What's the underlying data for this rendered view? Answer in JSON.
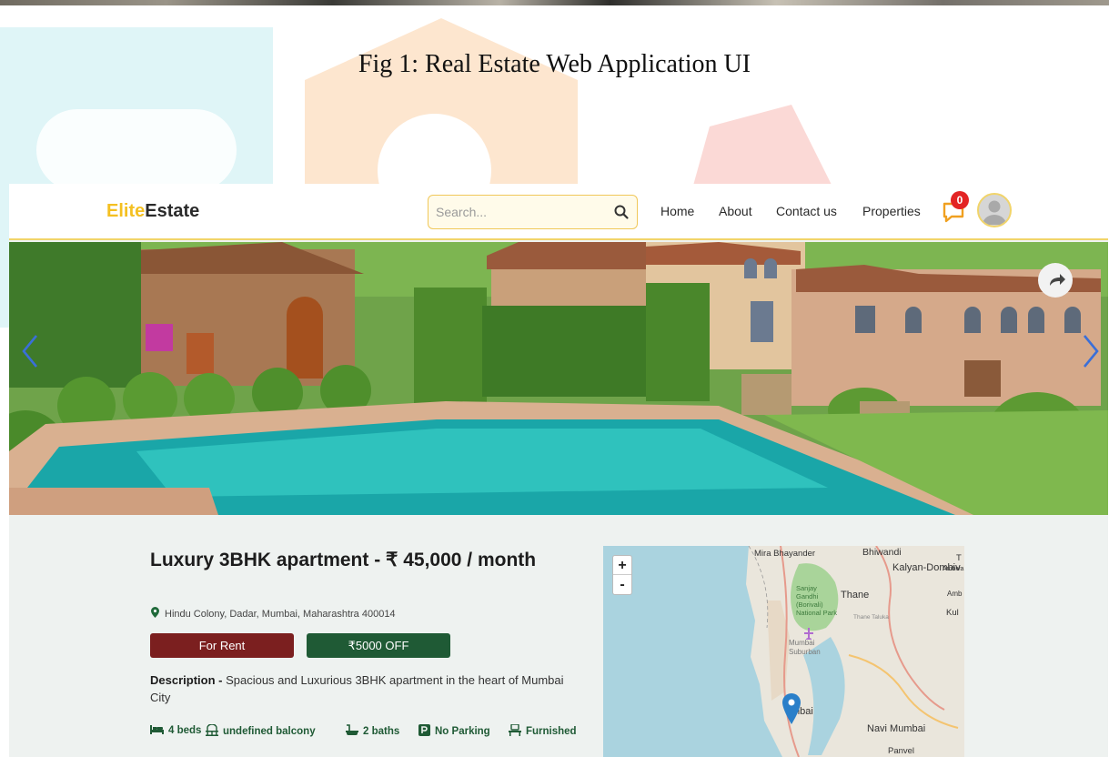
{
  "caption": "Fig 1: Real Estate Web Application UI",
  "app": {
    "logo": {
      "part1": "Elite",
      "part2": "Estate"
    },
    "search": {
      "placeholder": "Search...",
      "icon": "search-icon"
    },
    "nav": [
      "Home",
      "About",
      "Contact us",
      "Properties"
    ],
    "notifications": {
      "icon": "chat-bubble-icon",
      "count": "0"
    },
    "avatar_icon": "user-avatar-icon",
    "colors": {
      "accent": "#f4c022",
      "rent": "#7b1f1f",
      "discount": "#1f5a35",
      "feature": "#1f5a35"
    }
  },
  "listing": {
    "title": "Luxury 3BHK apartment - ₹ 45,000 / month",
    "address": "Hindu Colony, Dadar, Mumbai, Maharashtra 400014",
    "type_label": "For Rent",
    "discount_label": "₹5000 OFF",
    "description_label": "Description -",
    "description": " Spacious and Luxurious 3BHK apartment in the heart of Mumbai City",
    "features": [
      {
        "icon": "bed-icon",
        "label": "4 beds"
      },
      {
        "icon": "balcony-icon",
        "label": "undefined balcony"
      },
      {
        "icon": "bath-icon",
        "label": "2 baths"
      },
      {
        "icon": "parking-icon",
        "label": "No Parking"
      },
      {
        "icon": "chair-icon",
        "label": "Furnished"
      }
    ]
  },
  "map": {
    "zoom_in": "+",
    "zoom_out": "-",
    "labels": [
      "Mira Bhayander",
      "Bhiwandi",
      "Kalyan-Dombiv",
      "Sanjay Gandhi (Borivali) National Park",
      "Thane",
      "Mumbai Suburban",
      "mbai",
      "Navi Mumbai",
      "Panvel",
      "Ambiva",
      "Amb",
      "Kul",
      "T",
      "Thane Taluka"
    ]
  }
}
